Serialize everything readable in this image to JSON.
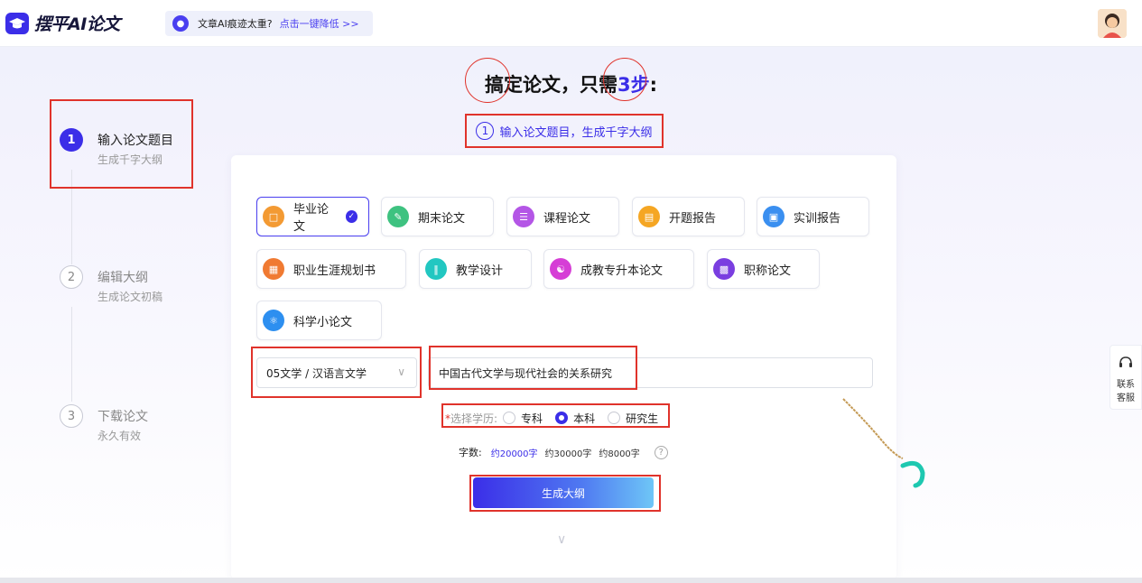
{
  "header": {
    "logo_text": "摆平AI论文",
    "notice_text": "文章AI痕迹太重?",
    "notice_link": "点击一键降低 >>"
  },
  "title": {
    "part1": "搞定论文，只需",
    "highlight": "3步",
    "colon": ":"
  },
  "subtitle": {
    "num": "1",
    "text": "输入论文题目，生成千字大纲"
  },
  "steps": [
    {
      "num": "1",
      "title": "输入论文题目",
      "sub": "生成千字大纲"
    },
    {
      "num": "2",
      "title": "编辑大纲",
      "sub": "生成论文初稿"
    },
    {
      "num": "3",
      "title": "下载论文",
      "sub": "永久有效"
    }
  ],
  "paper_types": [
    {
      "label": "毕业论文",
      "icon": "graduation-doc-icon",
      "color": "#f39a33"
    },
    {
      "label": "期末论文",
      "icon": "pencil-icon",
      "color": "#3ec280"
    },
    {
      "label": "课程论文",
      "icon": "book-stack-icon",
      "color": "#b456e6"
    },
    {
      "label": "开题报告",
      "icon": "report-icon",
      "color": "#f5a623"
    },
    {
      "label": "实训报告",
      "icon": "document-icon",
      "color": "#3a8ff0"
    },
    {
      "label": "职业生涯规划书",
      "icon": "plan-icon",
      "color": "#f07a32"
    },
    {
      "label": "教学设计",
      "icon": "ruler-pencil-icon",
      "color": "#22c7c1"
    },
    {
      "label": "成教专升本论文",
      "icon": "people-icon",
      "color": "#d63ed6"
    },
    {
      "label": "职称论文",
      "icon": "certificate-icon",
      "color": "#7a3ee0"
    },
    {
      "label": "科学小论文",
      "icon": "atom-icon",
      "color": "#2d8ff0"
    }
  ],
  "subject_select": {
    "value": "05文学 / 汉语言文学"
  },
  "topic_input": {
    "value": "中国古代文学与现代社会的关系研究"
  },
  "education": {
    "label": "选择学历:",
    "options": [
      "专科",
      "本科",
      "研究生"
    ],
    "selected": "本科"
  },
  "words": {
    "label": "字数:",
    "options": [
      "约20000字",
      "约30000字",
      "约8000字"
    ],
    "selected": "约20000字"
  },
  "generate_button": "生成大纲",
  "side_contact": {
    "line1": "联系",
    "line2": "客服"
  },
  "colors": {
    "accent": "#3b2ee8",
    "annotation_red": "#e0332b"
  }
}
